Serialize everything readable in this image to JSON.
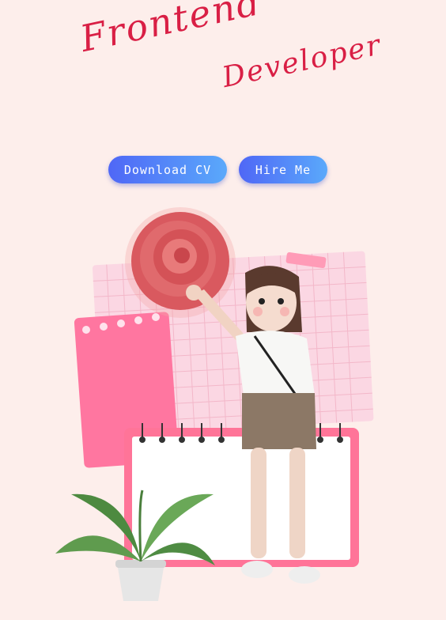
{
  "hero": {
    "title_line1": "Frontend",
    "title_line2": "Developer"
  },
  "actions": {
    "download_label": "Download CV",
    "hire_label": "Hire Me"
  },
  "colors": {
    "background": "#fdeeeb",
    "title": "#d91f45",
    "button_gradient_start": "#4f67f6",
    "button_gradient_end": "#5aa9fb",
    "pink_accent": "#ff7c9c"
  },
  "illustration": {
    "icons": [
      "rose-icon",
      "girl-character",
      "notebook-icon",
      "plant-icon",
      "grid-paper"
    ]
  }
}
